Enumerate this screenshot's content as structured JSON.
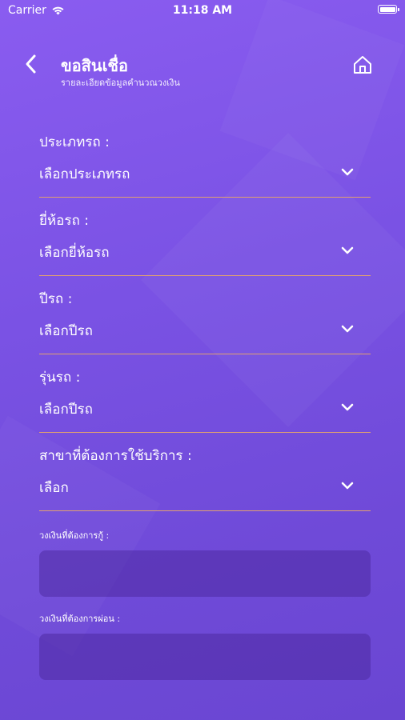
{
  "status_bar": {
    "carrier": "Carrier",
    "time": "11:18 AM"
  },
  "header": {
    "title": "ขอสินเชื่อ",
    "subtitle": "รายละเอียดข้อมูลคำนวณวงเงิน"
  },
  "form": {
    "fields": [
      {
        "label": "ประเภทรถ :",
        "value": "เลือกประเภทรถ"
      },
      {
        "label": "ยี่ห้อรถ :",
        "value": "เลือกยี่ห้อรถ"
      },
      {
        "label": "ปีรถ :",
        "value": "เลือกปีรถ"
      },
      {
        "label": "รุ่นรถ :",
        "value": "เลือกปีรถ"
      },
      {
        "label": "สาขาที่ต้องการใช้บริการ :",
        "value": "เลือก"
      }
    ],
    "loan_amount": {
      "label": "วงเงินที่ต้องการกู้ :",
      "value": ""
    },
    "installment_amount": {
      "label": "วงเงินที่ต้องการผ่อน :",
      "value": ""
    }
  },
  "colors": {
    "background_top": "#8a5cf0",
    "background_bottom": "#6a46d2",
    "divider": "#e0a070",
    "input_fill": "#5a35b8"
  },
  "icons": {
    "back": "chevron-left-icon",
    "home": "home-icon",
    "dropdown": "chevron-down-icon",
    "wifi": "wifi-icon",
    "battery": "battery-icon"
  }
}
